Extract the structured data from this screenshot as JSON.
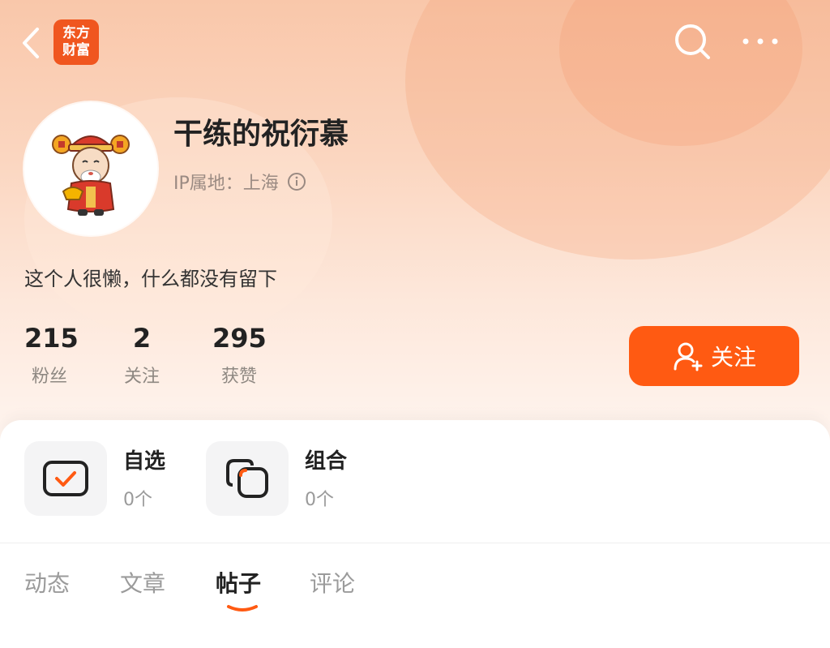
{
  "header": {
    "logo_line1": "东方",
    "logo_line2": "财富",
    "icons": [
      "back-arrow-icon",
      "search-icon",
      "more-icon"
    ]
  },
  "profile": {
    "username": "干练的祝衍慕",
    "ip_label": "IP属地：上海",
    "bio": "这个人很懒，什么都没有留下"
  },
  "stats": [
    {
      "value": "215",
      "label": "粉丝"
    },
    {
      "value": "2",
      "label": "关注"
    },
    {
      "value": "295",
      "label": "获赞"
    }
  ],
  "follow_button": {
    "label": "关注"
  },
  "tiles": [
    {
      "label": "自选",
      "count": "0个"
    },
    {
      "label": "组合",
      "count": "0个"
    }
  ],
  "tabs": [
    {
      "label": "动态",
      "active": false
    },
    {
      "label": "文章",
      "active": false
    },
    {
      "label": "帖子",
      "active": true
    },
    {
      "label": "评论",
      "active": false
    }
  ],
  "colors": {
    "accent": "#ff5a12",
    "brand": "#f0561f"
  }
}
